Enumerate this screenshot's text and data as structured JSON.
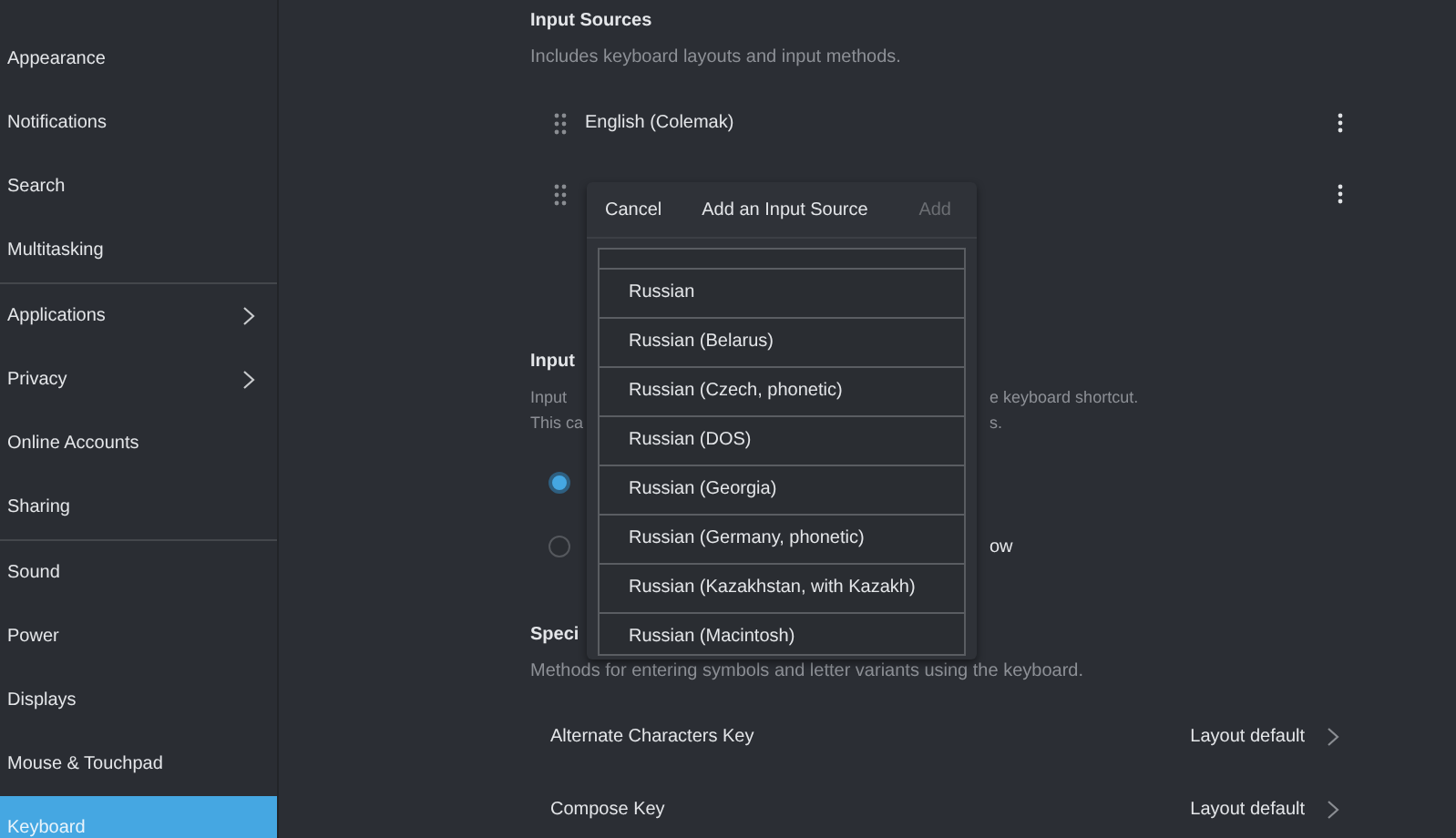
{
  "sidebar": {
    "groups": [
      {
        "items": [
          {
            "label": "Appearance",
            "expandable": false,
            "selected": false
          },
          {
            "label": "Notifications",
            "expandable": false,
            "selected": false
          },
          {
            "label": "Search",
            "expandable": false,
            "selected": false
          },
          {
            "label": "Multitasking",
            "expandable": false,
            "selected": false
          }
        ]
      },
      {
        "items": [
          {
            "label": "Applications",
            "expandable": true,
            "selected": false
          },
          {
            "label": "Privacy",
            "expandable": true,
            "selected": false
          },
          {
            "label": "Online Accounts",
            "expandable": false,
            "selected": false
          },
          {
            "label": "Sharing",
            "expandable": false,
            "selected": false
          }
        ]
      },
      {
        "items": [
          {
            "label": "Sound",
            "expandable": false,
            "selected": false
          },
          {
            "label": "Power",
            "expandable": false,
            "selected": false
          },
          {
            "label": "Displays",
            "expandable": false,
            "selected": false
          },
          {
            "label": "Mouse & Touchpad",
            "expandable": false,
            "selected": false
          },
          {
            "label": "Keyboard",
            "expandable": false,
            "selected": true
          }
        ]
      }
    ]
  },
  "input_sources": {
    "title": "Input Sources",
    "description": "Includes keyboard layouts and input methods.",
    "sources": [
      {
        "name": "English (Colemak)"
      }
    ]
  },
  "input_method": {
    "title": "Input",
    "line_1_start": "Input",
    "line_1_end": "e keyboard shortcut.",
    "line_2_start": "This ca",
    "line_2_end": "s.",
    "options": [
      {
        "selected": true
      },
      {
        "selected": false,
        "label_end": "ow"
      }
    ]
  },
  "special_characters": {
    "title": "Speci",
    "description": "Methods for entering symbols and letter variants using the keyboard.",
    "rows": [
      {
        "label": "Alternate Characters Key",
        "value": "Layout default"
      },
      {
        "label": "Compose Key",
        "value": "Layout default"
      }
    ]
  },
  "dialog": {
    "cancel": "Cancel",
    "title": "Add an Input Source",
    "add": {
      "label": "Add",
      "disabled": true
    },
    "items": [
      {
        "label": "Russian"
      },
      {
        "label": "Russian (Belarus)"
      },
      {
        "label": "Russian (Czech, phonetic)"
      },
      {
        "label": "Russian (DOS)"
      },
      {
        "label": "Russian (Georgia)"
      },
      {
        "label": "Russian (Germany, phonetic)"
      },
      {
        "label": "Russian (Kazakhstan, with Kazakh)"
      },
      {
        "label": "Russian (Macintosh)"
      }
    ]
  }
}
